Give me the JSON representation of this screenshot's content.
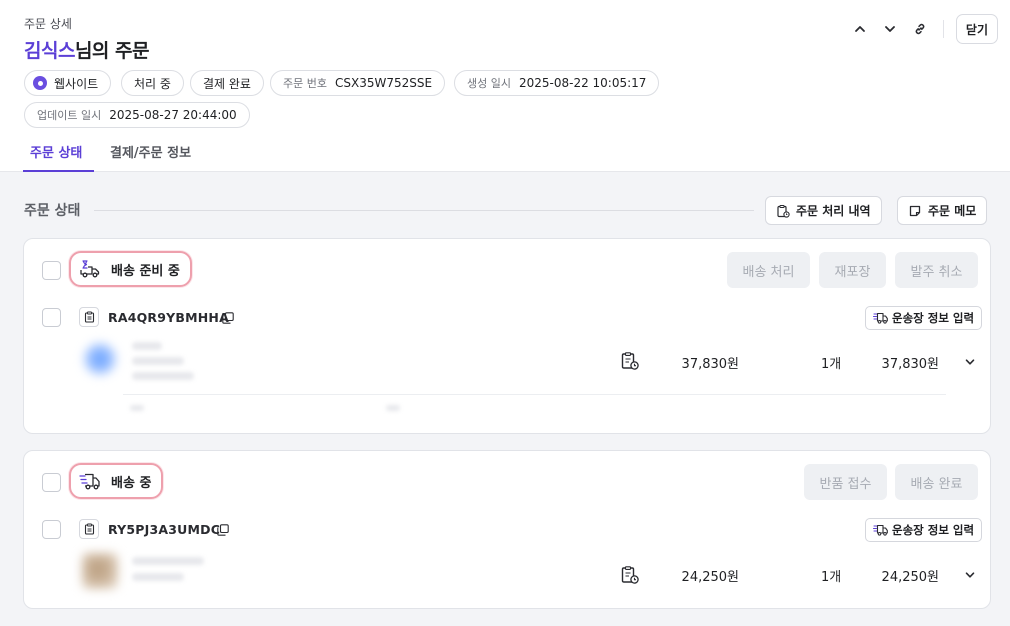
{
  "header": {
    "subtitle": "주문 상세",
    "customer_name": "김식스",
    "title_suffix": "님의 주문",
    "close_label": "닫기"
  },
  "chips": {
    "channel": "웹사이트",
    "processing": "처리 중",
    "payment": "결제 완료",
    "order_no_label": "주문 번호",
    "order_no": "CSX35W752SSE",
    "created_label": "생성 일시",
    "created": "2025-08-22 10:05:17",
    "updated_label": "업데이트 일시",
    "updated": "2025-08-27 20:44:00"
  },
  "tabs": [
    "주문 상태",
    "결제/주문 정보"
  ],
  "section": {
    "title": "주문 상태",
    "history_label": "주문 처리 내역",
    "memo_label": "주문 메모"
  },
  "groups": [
    {
      "status": "배송 준비 중",
      "actions": [
        "배송 처리",
        "재포장",
        "발주 취소"
      ],
      "order_code": "RA4QR9YBMHHA",
      "ship_label": "운송장 정보 입력",
      "price": "37,830원",
      "qty": "1개",
      "total": "37,830원"
    },
    {
      "status": "배송 중",
      "actions": [
        "반품 접수",
        "배송 완료"
      ],
      "order_code": "RY5PJ3A3UMDC",
      "ship_label": "운송장 정보 입력",
      "price": "24,250원",
      "qty": "1개",
      "total": "24,250원"
    }
  ],
  "colors": {
    "accent": "#5b3fd6",
    "status_outline": "#eea0ad",
    "disabled_bg": "#eef0f3"
  },
  "icons": {
    "up": "chevron-up-icon",
    "down": "chevron-down-icon",
    "link": "link-icon",
    "history": "clipboard-clock-icon",
    "memo": "memo-icon",
    "truck": "truck-icon",
    "copy": "copy-icon"
  }
}
